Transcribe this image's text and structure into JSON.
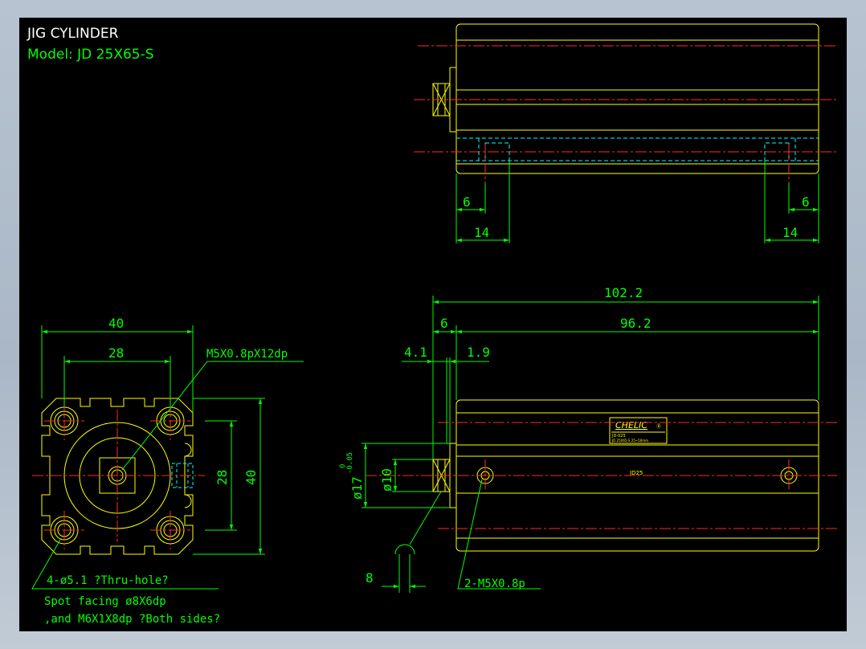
{
  "title_block": {
    "title": "JIG CYLINDER",
    "model": "Model:  JD 25X65-S"
  },
  "dimensions": {
    "top_left_6": "6",
    "top_right_6": "6",
    "top_left_14": "14",
    "top_right_14": "14",
    "overall_length": "102.2",
    "body_length": "96.2",
    "rod_end": "6",
    "dim_4_1": "4.1",
    "dim_1_9": "1.9",
    "bore_dia": "ø10",
    "rod_dia": "ø17",
    "tol_upper": "0",
    "tol_lower": "-0.05",
    "dim_8": "8",
    "width_40": "40",
    "width_28": "28",
    "height_28": "28",
    "height_40": "40"
  },
  "notes": {
    "thread_rod": "M5X0.8pX12dp",
    "thru_hole": "4-ø5.1 ?Thru-hole?",
    "spot_facing": "Spot facing  ø8X6dp",
    "m6_thread": ",and M6X1X8dp ?Both sides?",
    "port_thread": "2-M5X0.8p"
  },
  "nameplate": {
    "brand": "CHELIC",
    "mark": "Ⓡ",
    "line1": "JD-025",
    "line2": "JD 25X65-S  25~50mm"
  },
  "body_text": "JD25",
  "colors": {
    "background": "#000000",
    "outline": "#ffff00",
    "dimension": "#00ff00",
    "centerline": "#ff2a2a",
    "hidden": "#00ffff",
    "text_white": "#ffffff"
  }
}
